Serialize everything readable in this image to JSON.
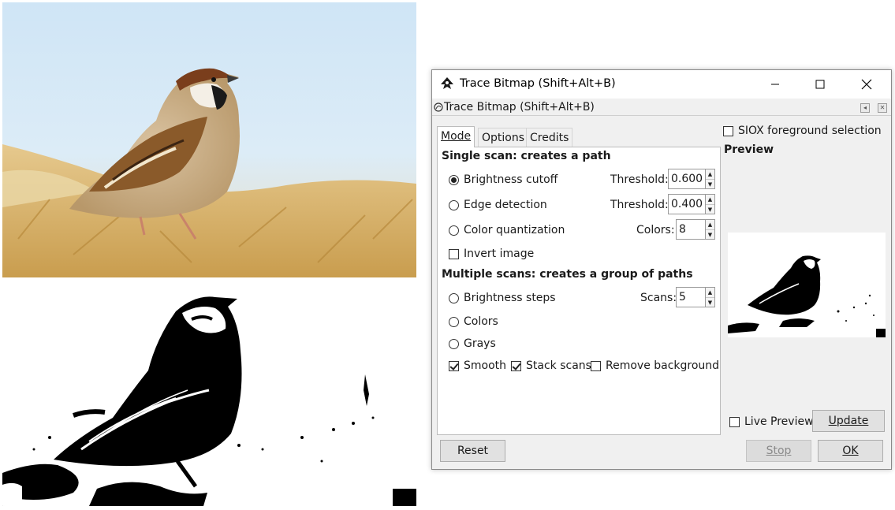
{
  "dialog": {
    "window_title": "Trace Bitmap (Shift+Alt+B)",
    "dock_title": "Trace Bitmap (Shift+Alt+B)",
    "tabs": [
      {
        "label": "Mode",
        "active": true
      },
      {
        "label": "Options",
        "active": false
      },
      {
        "label": "Credits",
        "active": false
      }
    ],
    "single_scan": {
      "heading": "Single scan: creates a path",
      "brightness_cutoff": {
        "label": "Brightness cutoff",
        "selected": true,
        "field_label": "Threshold:",
        "value": "0.600"
      },
      "edge_detection": {
        "label": "Edge detection",
        "selected": false,
        "field_label": "Threshold:",
        "value": "0.400"
      },
      "color_quantization": {
        "label": "Color quantization",
        "selected": false,
        "field_label": "Colors:",
        "value": "8"
      },
      "invert_image": {
        "label": "Invert image",
        "checked": false
      }
    },
    "multiple_scans": {
      "heading": "Multiple scans: creates a group of paths",
      "brightness_steps": {
        "label": "Brightness steps",
        "selected": false,
        "field_label": "Scans:",
        "value": "5"
      },
      "colors": {
        "label": "Colors",
        "selected": false
      },
      "grays": {
        "label": "Grays",
        "selected": false
      },
      "smooth": {
        "label": "Smooth",
        "checked": true
      },
      "stack_scans": {
        "label": "Stack scans",
        "checked": true
      },
      "remove_background": {
        "label": "Remove background",
        "checked": false
      }
    },
    "siox": {
      "label": "SIOX foreground selection",
      "checked": false
    },
    "preview_heading": "Preview",
    "live_preview": {
      "label": "Live Preview",
      "checked": false
    },
    "buttons": {
      "update": "Update",
      "reset": "Reset",
      "stop": "Stop",
      "ok": "OK"
    }
  },
  "images": {
    "photo": "sparrow-photo",
    "trace": "sparrow-black-white-trace"
  },
  "colors": {
    "sky": "#d7e9f7",
    "grass": "#d8b46a",
    "dialog_bg": "#f0f0f0"
  }
}
